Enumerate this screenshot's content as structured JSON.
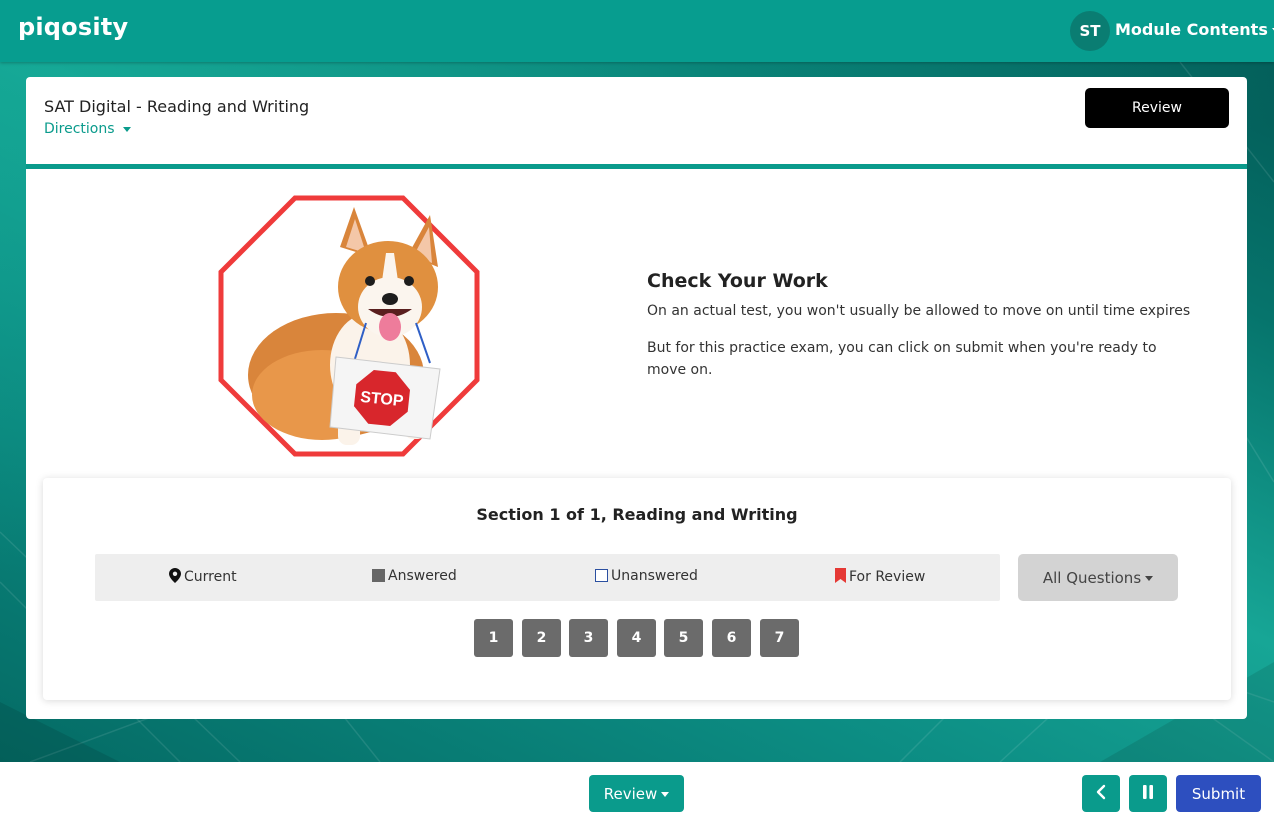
{
  "header": {
    "logo": "piqosity",
    "avatar_initials": "ST",
    "module_menu_label": "Module Contents"
  },
  "test": {
    "title": "SAT Digital - Reading and Writing",
    "directions_label": "Directions",
    "review_label": "Review"
  },
  "content": {
    "illustration": "corgi-stop-sign",
    "heading": "Check Your Work",
    "paragraph1": "On an actual test, you won't usually be allowed to move on until time expires",
    "paragraph2": "But for this practice exam, you can click on submit when you're ready to move on."
  },
  "section": {
    "title": "Section 1 of 1, Reading and Writing",
    "legend": {
      "current": "Current",
      "answered": "Answered",
      "unanswered": "Unanswered",
      "for_review": "For Review"
    },
    "filter_label": "All Questions",
    "questions": [
      "1",
      "2",
      "3",
      "4",
      "5",
      "6",
      "7"
    ]
  },
  "footer": {
    "review_label": "Review",
    "back_icon": "chevron-left-icon",
    "pause_icon": "pause-icon",
    "submit_label": "Submit"
  },
  "colors": {
    "teal": "#0a9b8c",
    "submit": "#2d4fbf",
    "question": "#6b6b6b",
    "review_flag": "#e53935"
  }
}
